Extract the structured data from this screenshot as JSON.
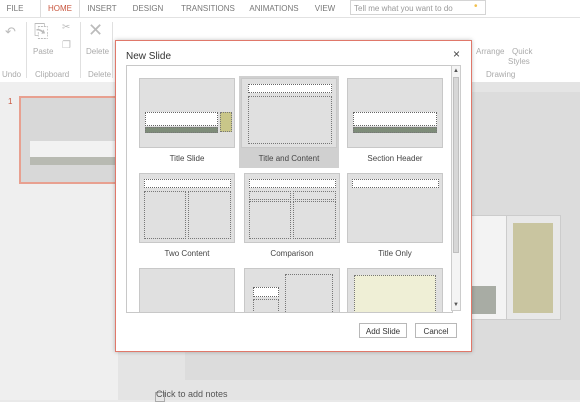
{
  "ribbon": {
    "tabs": [
      {
        "label": "FILE"
      },
      {
        "label": "HOME"
      },
      {
        "label": "INSERT"
      },
      {
        "label": "DESIGN"
      },
      {
        "label": "TRANSITIONS"
      },
      {
        "label": "ANIMATIONS"
      },
      {
        "label": "VIEW"
      }
    ],
    "active_tab": "HOME",
    "tell_me_placeholder": "Tell me what you want to do",
    "groups": {
      "undo": "Undo",
      "clipboard": "Clipboard",
      "delete_group": "Delete",
      "drawing": "Drawing"
    },
    "buttons": {
      "paste": "Paste",
      "delete": "Delete",
      "arrange": "Arrange",
      "quick_styles_line1": "Quick",
      "quick_styles_line2": "Styles"
    }
  },
  "thumbnails": {
    "slide_number": "1"
  },
  "notes_placeholder": "Click to add notes",
  "dialog": {
    "title": "New Slide",
    "close_symbol": "×",
    "layouts": [
      {
        "name": "Title Slide"
      },
      {
        "name": "Title and Content",
        "selected": true
      },
      {
        "name": "Section Header"
      },
      {
        "name": "Two Content"
      },
      {
        "name": "Comparison"
      },
      {
        "name": "Title Only"
      }
    ],
    "buttons": {
      "add_slide": "Add Slide",
      "cancel": "Cancel"
    }
  },
  "colors": {
    "accent": "#c8553d",
    "dialog_border": "#e0786a",
    "placeholder_green": "#7e8c79",
    "placeholder_olive": "#c9c689",
    "cream_fill": "#efefd6"
  },
  "icons": [
    "undo-icon",
    "paste-icon",
    "cut-icon",
    "copy-icon",
    "delete-icon",
    "lightbulb-icon",
    "close-icon",
    "scroll-up-icon",
    "scroll-down-icon"
  ]
}
